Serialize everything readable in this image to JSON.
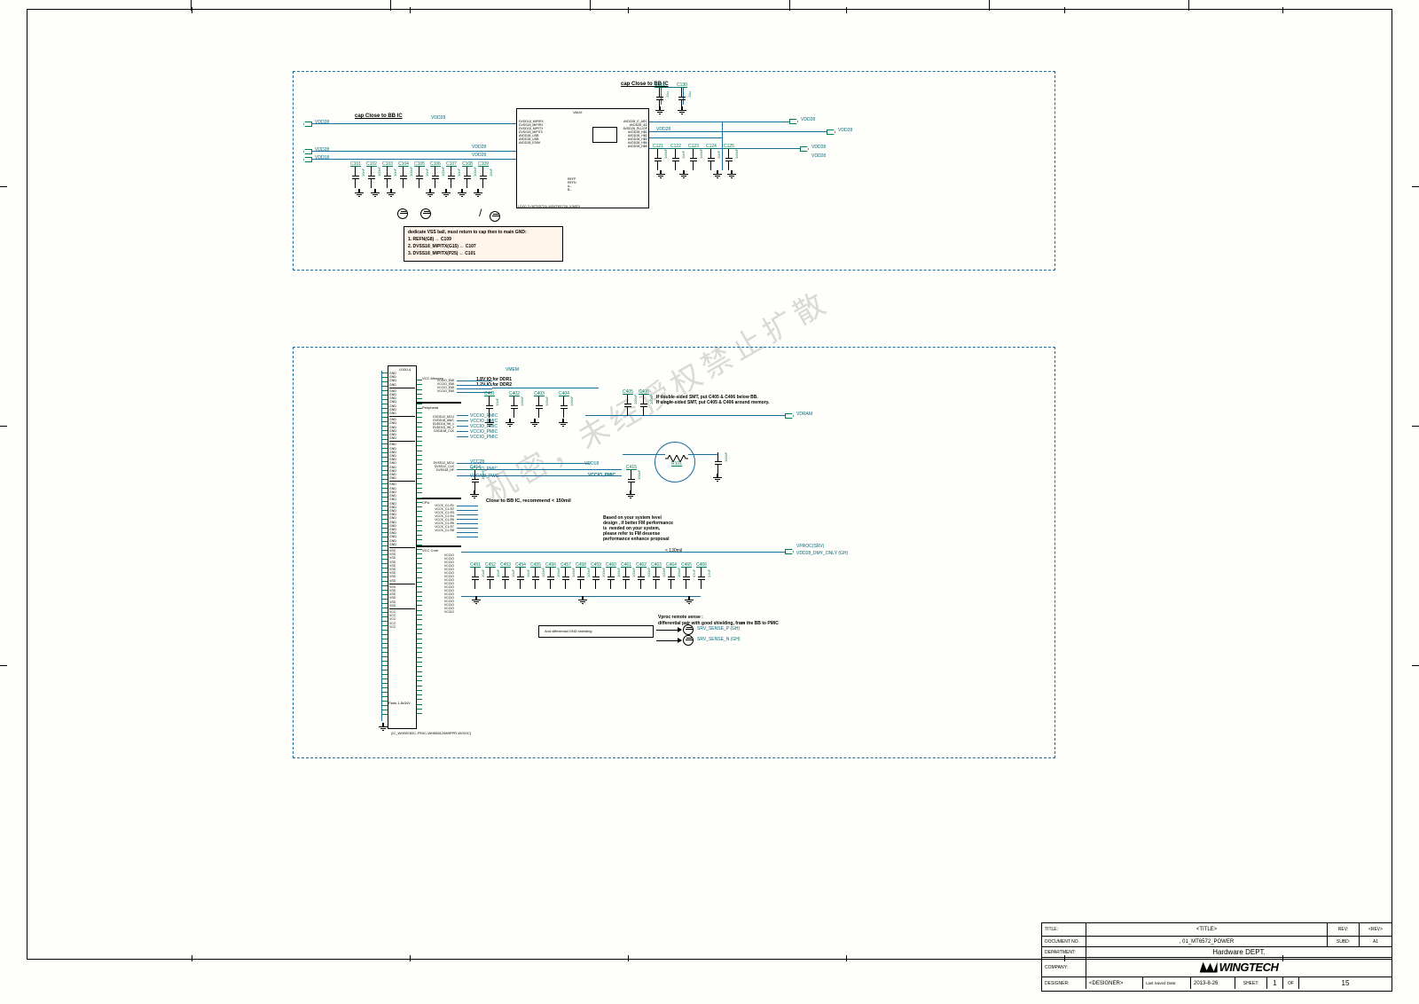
{
  "titleblock": {
    "title_lab": "TITLE:",
    "title": "<TITLE>",
    "rev_lab": "REV:",
    "rev": "<REV>",
    "doc_lab": "DOCUMENT NO.",
    "doc": ", 01_MT6572_POWER",
    "subd_lab": "SUBD:",
    "subd": "A1",
    "dept_lab": "DEPARTMENT:",
    "dept": "Hardware DEPT.",
    "company_lab": "COMPANY:",
    "company": "WINGTECH",
    "designer_lab": "DESIGNER:",
    "designer": "<DESIGNER>",
    "date_lab": "Last Saved Date:",
    "date": "2013-8-26",
    "sheet_lab": "SHEET:",
    "sheet_cur": "1",
    "sheet_of": "OF",
    "sheet_tot": "15"
  },
  "top": {
    "title1": "cap Close to BB IC",
    "title2": "cap Close to BB IC",
    "heading": "VAUX",
    "ic_ref": "U100-3 (MT6572A-W/MT6572A-X/M/D)",
    "left_net_1": "VDD28",
    "left_net_2": "VDD28",
    "left_net_3": "VDD18",
    "right_net_1": "VDD28",
    "right_net_2": "VDD28",
    "right_net_3": "VDD28",
    "right_net_4": "VDD28",
    "right_net_5": "VDD28",
    "ref_net_1": "VDD28",
    "ref_net_2": "VDD28",
    "ref_net_3": "VDD28",
    "note_block": [
      "dedicate VSS  ball, must return to cap then to main GND:",
      "1. REFN(G8) ↔ C109",
      "2. DVSS18_MIPITX(G15) ↔ C107",
      "3. DVSS18_MIPITX(P25) ↔ C101"
    ],
    "ic_left_pins": [
      "DVDD18_MIPIRX",
      "DVSS18_MIPIRX",
      "DVDD18_MIPITX",
      "DVSS18_MIPITX",
      "AVDD28_USB",
      "AVDD28_USB",
      "AVDD28_ESIM"
    ],
    "ic_mid_pins": [
      "REFP",
      "REFN",
      "A...",
      "B..."
    ],
    "ic_right_pins": [
      "AVDD28_E_ARC",
      "AVDD28_AD",
      "AVDD28_PLL/GP",
      "AVDD28_HB1",
      "AVDD28_HB2",
      "AVDD28_HB3",
      "AVDD28_HB4",
      "AVDD28_HB5"
    ],
    "caps_top": [
      {
        "ref": "C131",
        "val": "10u"
      },
      {
        "ref": "C130",
        "val": "10u"
      }
    ],
    "caps_row": [
      {
        "ref": "C101",
        "val": "10nF"
      },
      {
        "ref": "C102",
        "val": "100nF"
      },
      {
        "ref": "C103",
        "val": "10nF"
      },
      {
        "ref": "C104",
        "val": "100nF"
      },
      {
        "ref": "C105",
        "val": "10nF"
      },
      {
        "ref": "C106",
        "val": "100nF"
      },
      {
        "ref": "C107",
        "val": "10nF"
      },
      {
        "ref": "C108",
        "val": "100nF"
      },
      {
        "ref": "C109",
        "val": "10nF"
      }
    ],
    "caps_right": [
      {
        "ref": "C121",
        "val": "100nF"
      },
      {
        "ref": "C122",
        "val": "10nF"
      },
      {
        "ref": "C123",
        "val": "100nF"
      },
      {
        "ref": "C124",
        "val": "10nF"
      },
      {
        "ref": "C125",
        "val": "100nF"
      }
    ],
    "note_right": [
      "Close to BB IC"
    ]
  },
  "bottom": {
    "ic_ref": "U100-4",
    "mcu_lbl": "VCC Memory",
    "peripheral_lbl": "Peripheral",
    "cpu_lbl": "CPU",
    "vcccore_lbl": "VCC Core",
    "pads_lbl": "Pads  1.8z34V",
    "pins_mem": [
      "VCCIO_EMI",
      "VCCIO_EMI",
      "VCCIO_EMI",
      "VCCIO_EMI"
    ],
    "pins_peri": [
      "DVDD12_MCU",
      "DVDD18_AWC",
      "DVDD18_H8_1",
      "DVDD18_H8_2",
      "DVDD18_CLK"
    ],
    "pins_sig": [
      "DVSS12_MCU",
      "DVSS12_CLK",
      "DVSS18_HF"
    ],
    "pins_cpu": [
      "VCCK_C1-R1",
      "VCCK_C1-R2",
      "VCCK_C1-R3",
      "VCCK_C1-R4",
      "VCCK_C1-R5",
      "VCCK_C1-R6",
      "VCCK_C1-R7",
      "VCCK_C1-R8"
    ],
    "pins_vcc": [
      "VCCIO",
      "VCCIO",
      "VCCIO",
      "VCCIO",
      "VCCIO",
      "VCCIO",
      "VCCIO",
      "VCCIO",
      "VCCIO",
      "VCCIO",
      "VCCIO",
      "VCCIO",
      "VCCIO",
      "VCCIO",
      "VCCIO",
      "VCCIO",
      "VCCIO"
    ],
    "gnd_groups": [
      "VSS",
      "VSS",
      "VSS",
      "VSS",
      "VSS",
      "VSS",
      "VSS",
      "VSS",
      "VSS",
      "VSS",
      "VSS",
      "VSS",
      "VSS",
      "VSS",
      "VSS",
      "VSS",
      "VSS",
      "VSS",
      "VSS",
      "VSS"
    ],
    "n_vccio_pmic": "VCCIO_PMIC",
    "n_vccio_pmic_2": "VCCIO_PMIC",
    "n_vccio_pmic_right": "VCCIO_PMIC",
    "n_vcc28": "VCC28",
    "n_vmem": "VMEM",
    "n_vdram": "VDRAM_PWC",
    "n_vdram2": "VDRAM",
    "n_vdd18": "VDD18",
    "note_io": "1.8V IO for DDR1\n1.2V IO for DDR2",
    "note_smt": "If double-sided SMT, put C405 & C406 below BB.\nIf single-sided SMT, put C405 & C406 around memory.",
    "note_close": "Close to BB IC, recommend < 150mil",
    "note_fm": "Based on your system level\ndesign , if better FM performance\nis  needed on your system,\nplease refer to FM desense\nperformance enhance proposal",
    "arrow_lbl": "< 130mil",
    "n_right_1": "VDD28",
    "n_vproc": "VPROC(SRV)",
    "n_vproc_dmy": "VDD28_DMY_ONLY (GH)",
    "vproc_note": [
      "Vproc remote sense :",
      "differential pair with good shielding, from the BB to PMIC"
    ],
    "srv_lines": [
      "SRV_SENSE_P (GH)",
      "SRV_SENSE_N (GH)"
    ],
    "diff_note": "And  differential  GND shielding",
    "caps_io": [
      {
        "ref": "C401",
        "val": "10uF"
      },
      {
        "ref": "C402",
        "val": "100nF"
      },
      {
        "ref": "C403",
        "val": "100nF"
      },
      {
        "ref": "C404",
        "val": "100nF"
      }
    ],
    "caps_mem": [
      {
        "ref": "C405",
        "val": "100nF"
      },
      {
        "ref": "C406",
        "val": "100nF"
      }
    ],
    "caps_sig": [
      {
        "ref": "C414",
        "val": "100nF"
      },
      {
        "ref": "C415",
        "val": "100nF"
      }
    ],
    "res_fm": "R101",
    "caps_proc": [
      {
        "ref": "C451",
        "val": "10uF"
      },
      {
        "ref": "C452",
        "val": "10uF"
      },
      {
        "ref": "C453",
        "val": "10uF"
      },
      {
        "ref": "C454",
        "val": "10uF"
      },
      {
        "ref": "C455",
        "val": "100nF"
      },
      {
        "ref": "C456",
        "val": "100nF"
      },
      {
        "ref": "C457",
        "val": "100nF"
      },
      {
        "ref": "C458",
        "val": "100nF"
      },
      {
        "ref": "C459",
        "val": "100nF"
      },
      {
        "ref": "C460",
        "val": "100nF"
      },
      {
        "ref": "C461",
        "val": "100nF"
      },
      {
        "ref": "C462",
        "val": "100nF"
      },
      {
        "ref": "C463",
        "val": "100nF"
      },
      {
        "ref": "C464",
        "val": "100nF"
      },
      {
        "ref": "C465",
        "val": "47nF"
      },
      {
        "ref": "C466",
        "val": "47nF"
      }
    ],
    "watermark": "机密，未经授权禁止扩散"
  }
}
